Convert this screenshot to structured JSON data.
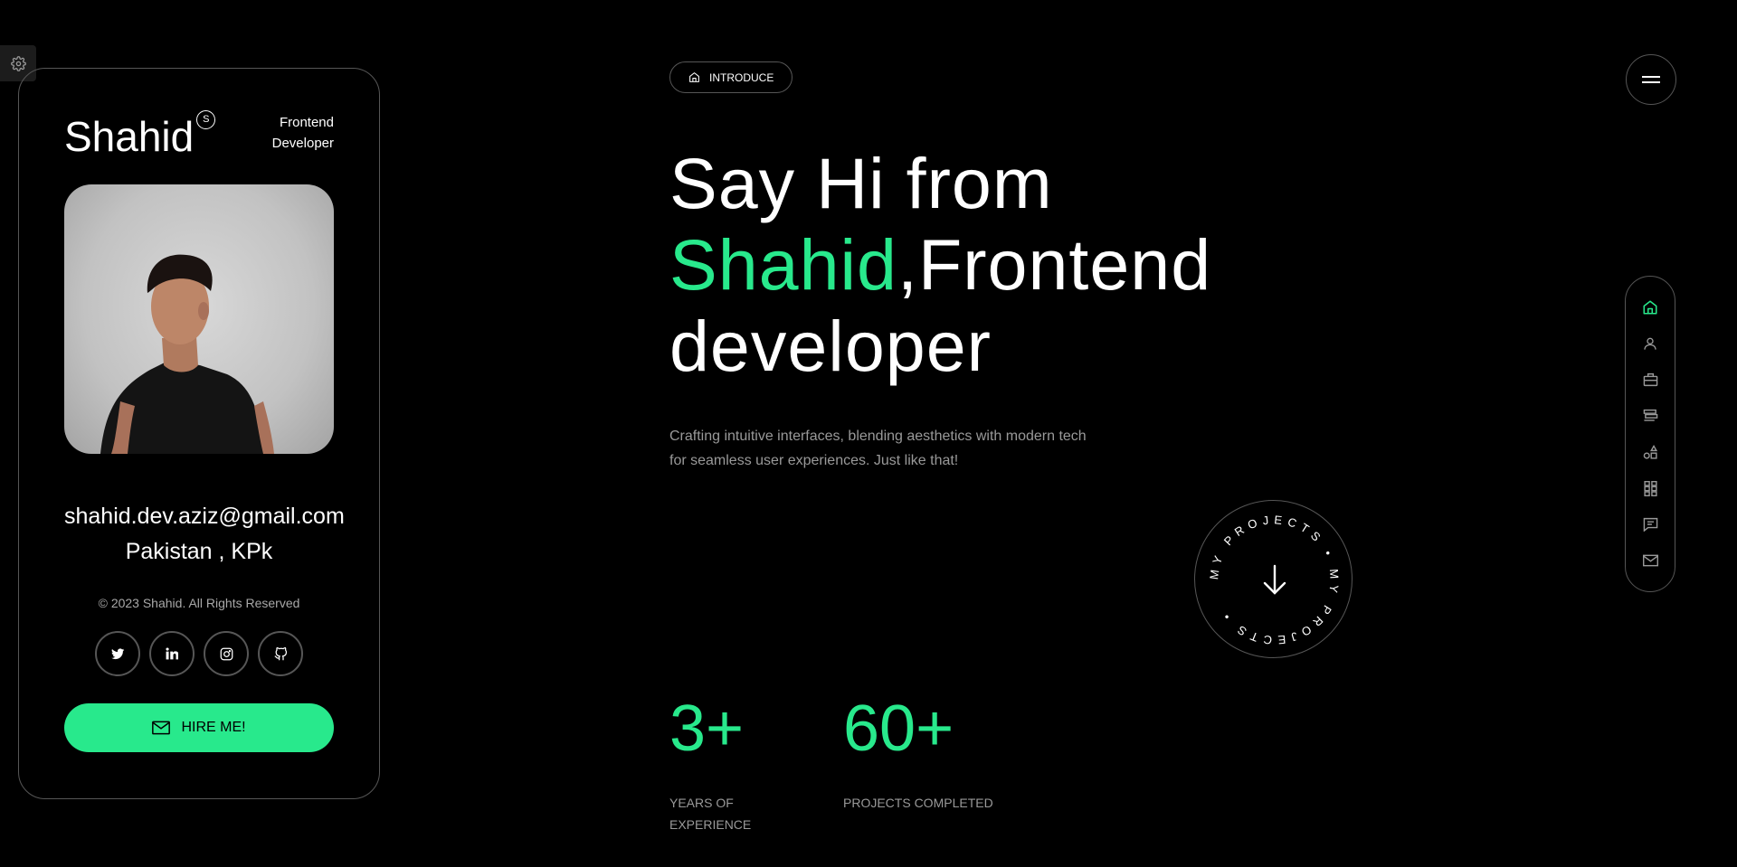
{
  "settings": {
    "icon": "gear-icon"
  },
  "profile": {
    "name": "Shahid",
    "badge": "S",
    "role": "Frontend\nDeveloper",
    "email": "shahid.dev.aziz@gmail.com",
    "location": "Pakistan , KPk",
    "copyright": "© 2023 Shahid. All Rights Reserved",
    "socials": [
      {
        "icon": "twitter-icon"
      },
      {
        "icon": "linkedin-icon"
      },
      {
        "icon": "instagram-icon"
      },
      {
        "icon": "github-icon"
      }
    ],
    "hire_label": "HIRE ME!"
  },
  "intro": {
    "pill_label": "INTRODUCE",
    "hero_line1": "Say Hi from",
    "hero_name": "Shahid",
    "hero_rest": ",Frontend",
    "hero_line3": "developer",
    "subtitle": "Crafting intuitive interfaces, blending aesthetics with modern tech for seamless user experiences. Just like that!",
    "circle_text": "MY PROJECTS • MY PROJECTS •"
  },
  "stats": [
    {
      "value": "3+",
      "label": "YEARS OF\nEXPERIENCE"
    },
    {
      "value": "60+",
      "label": "PROJECTS COMPLETED"
    }
  ],
  "nav": [
    "home-icon",
    "user-icon",
    "briefcase-icon",
    "resume-icon",
    "services-icon",
    "portfolio-grid-icon",
    "testimonial-icon",
    "mail-icon"
  ],
  "colors": {
    "accent": "#28e98c",
    "background": "#000000",
    "border": "#565656"
  }
}
